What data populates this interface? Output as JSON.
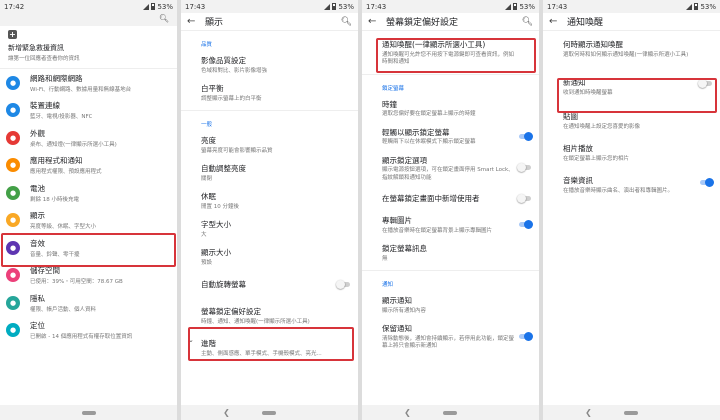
{
  "colors": {
    "accent": "#1a73e8",
    "highlight": "#d7343a"
  },
  "icons": [
    "search-icon",
    "back-arrow-icon",
    "plus-icon",
    "signal-icon",
    "wifi-icon",
    "battery-icon",
    "chevron-down-icon"
  ],
  "panel1": {
    "status": {
      "time": "17:42",
      "battery": "53%"
    },
    "emergency": {
      "title": "新增緊急救援資訊",
      "subtitle": "讓第一位回應者查看你的資訊"
    },
    "items": [
      {
        "title": "網路和網際網路",
        "subtitle": "Wi-Fi、行動網路、數據用量和無線基地台",
        "color": "#1e88e5"
      },
      {
        "title": "裝置連線",
        "subtitle": "藍牙、電視/投影器、NFC",
        "color": "#1e88e5"
      },
      {
        "title": "外觀",
        "subtitle": "桌布、通知燈(一律顯示所選小工具)",
        "color": "#e53935"
      },
      {
        "title": "應用程式和通知",
        "subtitle": "應用程式權限、預設應用程式",
        "color": "#fb8c00"
      },
      {
        "title": "電池",
        "subtitle": "剩餘 18 小時後充電",
        "color": "#43a047"
      },
      {
        "title": "顯示",
        "subtitle": "亮度等級、休眠、字型大小",
        "color": "#f9a825"
      },
      {
        "title": "音效",
        "subtitle": "音量、鈴聲、零干擾",
        "color": "#5e35b1"
      },
      {
        "title": "儲存空間",
        "subtitle": "已使用：39%・可用空間：78.67 GB",
        "color": "#ec407a"
      },
      {
        "title": "隱私",
        "subtitle": "權限、帳戶活動、個人資料",
        "color": "#26a69a"
      },
      {
        "title": "定位",
        "subtitle": "已開啟 - 14 個應用程式有權存取位置資訊",
        "color": "#00acc1"
      }
    ]
  },
  "panel2": {
    "status": {
      "time": "17:43",
      "battery": "53%"
    },
    "title": "顯示",
    "section1": "品質",
    "section2": "一般",
    "items_a": [
      {
        "title": "影像品質設定",
        "subtitle": "色域和對比、影片影像增強"
      },
      {
        "title": "白平衡",
        "subtitle": "調整顯示螢幕上的白平衡"
      }
    ],
    "items_b": [
      {
        "title": "亮度",
        "subtitle": "螢幕亮度可能會影響顯示品質"
      },
      {
        "title": "自動調整亮度",
        "subtitle": "關閉"
      },
      {
        "title": "休眠",
        "subtitle": "閒置 10 分鐘後"
      },
      {
        "title": "字型大小",
        "subtitle": "大"
      },
      {
        "title": "顯示大小",
        "subtitle": "預設"
      }
    ],
    "auto_rotate": "自動旋轉螢幕",
    "lock_screen": {
      "title": "螢幕鎖定偏好設定",
      "subtitle": "時鐘、通知、通知喚醒(一律顯示所選小工具)"
    },
    "advanced": {
      "title": "進階",
      "subtitle": "主動、側面感應、單手模式、手機殼模式、亮光..."
    }
  },
  "panel3": {
    "status": {
      "time": "17:43",
      "battery": "53%"
    },
    "title": "螢幕鎖定偏好設定",
    "top_item": {
      "title": "通知喚醒(一律顯示所選小工具)",
      "subtitle": "通知喚醒可允許您不用按下電源鍵即可查看資訊，例如時間和通知"
    },
    "section1": "鎖定螢幕",
    "items": [
      {
        "title": "時鐘",
        "subtitle": "選取您偏好要在鎖定螢幕上顯示的時鐘"
      },
      {
        "title": "輕觸以顯示鎖定螢幕",
        "subtitle": "輕觸兩下以在休眠模式下顯示鎖定螢幕"
      },
      {
        "title": "顯示鎖定選項",
        "subtitle": "顯示電源按鈕選項，可在鎖定畫面停用 Smart Lock、指紋解鎖和通知功能"
      },
      {
        "title": "在螢幕鎖定畫面中新增使用者",
        "subtitle": ""
      },
      {
        "title": "專輯圖片",
        "subtitle": "在播放音樂時在鎖定螢幕背景上顯示專輯圖片"
      },
      {
        "title": "鎖定螢幕訊息",
        "subtitle": "無"
      }
    ],
    "section2": "通知",
    "items2": [
      {
        "title": "顯示通知",
        "subtitle": "顯示所有通知內容"
      },
      {
        "title": "保留通知",
        "subtitle": "清除動態後，通知會持續顯示，若停用此功能，鎖定螢幕上將只會顯示新通知"
      }
    ]
  },
  "panel4": {
    "status": {
      "time": "17:43",
      "battery": "53%"
    },
    "title": "通知喚醒",
    "items": [
      {
        "title": "何時顯示通知喚醒",
        "subtitle": "選取何時和如何顯示通知喚醒(一律顯示所選小工具)"
      },
      {
        "title": "新通知",
        "subtitle": "收到通知時喚醒螢幕"
      },
      {
        "title": "貼圖",
        "subtitle": "在通知喚醒上設定您喜愛的影像"
      },
      {
        "title": "相片播放",
        "subtitle": "在鎖定螢幕上顯示您的相片"
      },
      {
        "title": "音樂資訊",
        "subtitle": "在播放音樂時顯示曲名、演出者和專輯圖片。"
      }
    ]
  }
}
